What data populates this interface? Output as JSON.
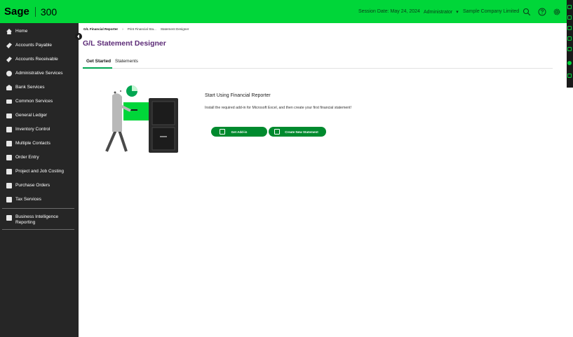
{
  "topbar": {
    "logo": "Sage",
    "product": "300",
    "session_date": "Session Date: May 24, 2024",
    "user": "Administrator",
    "user_caret": "▾",
    "company": "Sample Company Limited",
    "icons": [
      "search-icon",
      "help-icon",
      "settings-icon"
    ],
    "brand_color": "#00d639"
  },
  "sidebar": {
    "items": [
      {
        "label": "Home",
        "icon": "home-icon"
      },
      {
        "label": "Accounts Payable",
        "icon": "accounts-payable-icon"
      },
      {
        "label": "Accounts Receivable",
        "icon": "accounts-receivable-icon"
      },
      {
        "label": "Administrative Services",
        "icon": "administrative-services-icon"
      },
      {
        "label": "Bank Services",
        "icon": "bank-icon"
      },
      {
        "label": "Common Services",
        "icon": "common-services-icon"
      },
      {
        "label": "General Ledger",
        "icon": "general-ledger-icon"
      },
      {
        "label": "Inventory Control",
        "icon": "inventory-icon"
      },
      {
        "label": "Multiple Contacts",
        "icon": "contacts-icon"
      },
      {
        "label": "Order Entry",
        "icon": "order-entry-icon"
      },
      {
        "label": "Project and Job Costing",
        "icon": "project-icon"
      },
      {
        "label": "Purchase Orders",
        "icon": "purchase-orders-icon"
      },
      {
        "label": "Tax Services",
        "icon": "tax-icon"
      },
      {
        "label": "Business Intelligence Reporting",
        "icon": "bi-reporting-icon"
      }
    ]
  },
  "breadcrumb": {
    "items": [
      "G/L Financial Reporter",
      "Print Financial Sta...",
      "Statement Designer"
    ],
    "separator": "›"
  },
  "page": {
    "title": "G/L Statement Designer",
    "title_color": "#5c2b77"
  },
  "tabs": [
    {
      "label": "Get Started",
      "active": true
    },
    {
      "label": "Statements",
      "active": false
    }
  ],
  "get_started": {
    "heading": "Start Using Financial Reporter",
    "description": "Install the required add-in for Microsoft Excel, and then create your first financial statement!",
    "get_addin_label": "Get Add-in",
    "create_statement_label": "Create New Statement",
    "button_color": "#008a2e"
  }
}
